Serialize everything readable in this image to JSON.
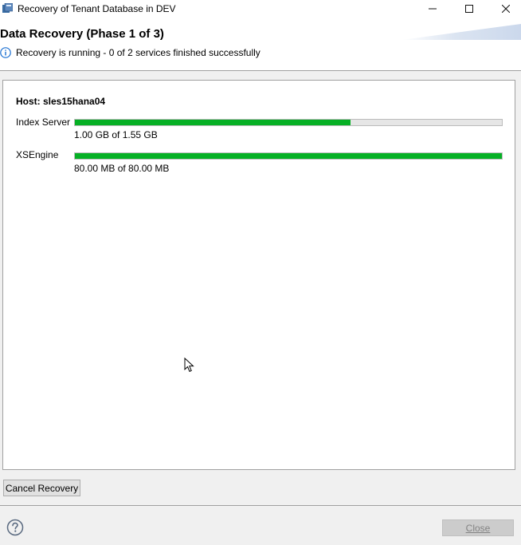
{
  "window": {
    "title": "Recovery of Tenant Database in DEV",
    "minimize_glyph": "—",
    "maximize_glyph": "☐",
    "close_glyph": "✕"
  },
  "header": {
    "title": "Data Recovery (Phase 1 of 3)",
    "status": "Recovery is running - 0 of 2 services finished successfully",
    "status_icon": "info-icon"
  },
  "host": {
    "label": "Host: sles15hana04"
  },
  "services": [
    {
      "name": "Index Server",
      "progress_percent": 64.5,
      "size_text": "1.00 GB of 1.55 GB"
    },
    {
      "name": "XSEngine",
      "progress_percent": 100,
      "size_text": "80.00 MB of 80.00 MB"
    }
  ],
  "footer": {
    "cancel_label": "Cancel Recovery",
    "close_label": "Close",
    "help_icon": "help-icon"
  },
  "colors": {
    "progress_fill": "#06b025",
    "progress_track": "#e6e6e6",
    "info_icon": "#1a6fd1"
  }
}
